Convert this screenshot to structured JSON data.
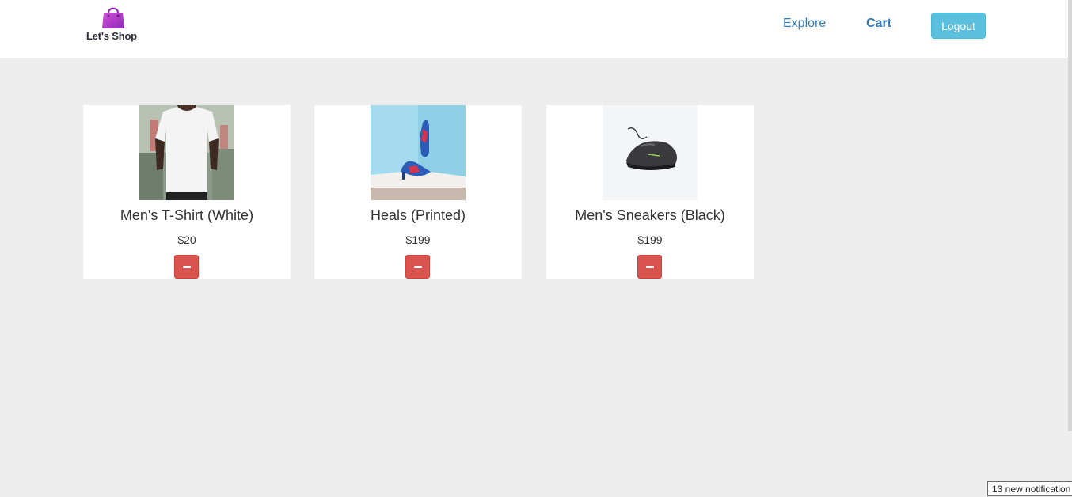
{
  "brand": {
    "name": "Let's Shop",
    "logo_icon": "shopping-bag-icon",
    "logo_color": "#b43ec6"
  },
  "nav": {
    "explore_label": "Explore",
    "cart_label": "Cart",
    "logout_label": "Logout"
  },
  "cart": {
    "items": [
      {
        "name": "Men's T-Shirt (White)",
        "price": "$20",
        "image": "white-tshirt-photo"
      },
      {
        "name": "Heals (Printed)",
        "price": "$199",
        "image": "printed-heels-photo"
      },
      {
        "name": "Men's Sneakers (Black)",
        "price": "$199",
        "image": "black-sneaker-photo"
      }
    ],
    "remove_icon": "minus-icon"
  },
  "notification": {
    "text": "13 new notification"
  },
  "colors": {
    "link": "#337ab7",
    "logout": "#5bc0de",
    "remove": "#d9534f",
    "background": "#ededed"
  }
}
